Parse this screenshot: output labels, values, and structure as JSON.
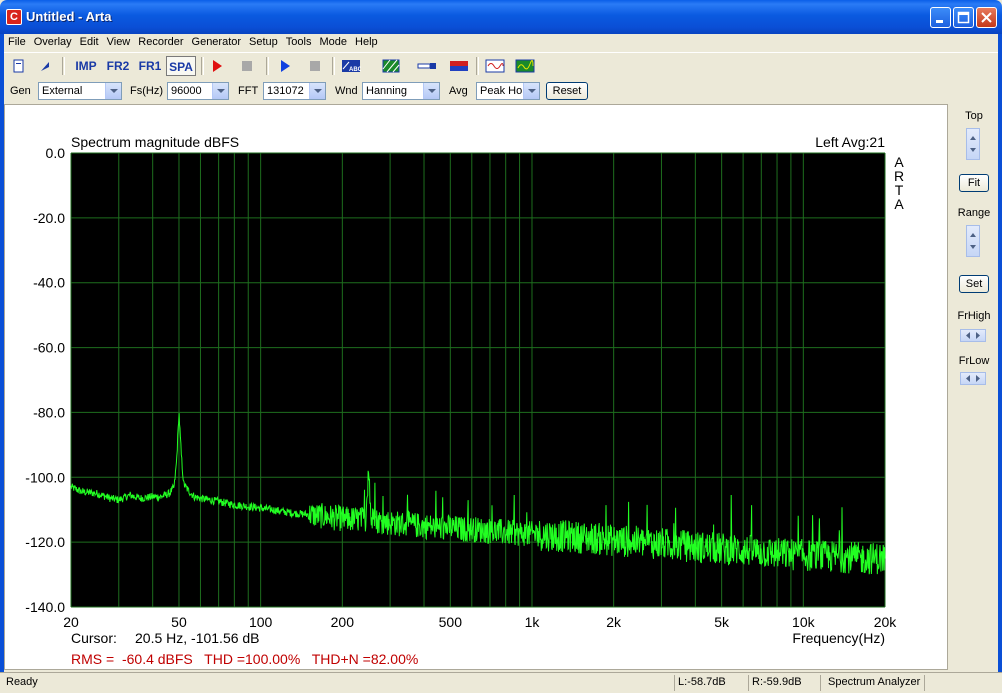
{
  "window": {
    "title": "Untitled - Arta",
    "icon": "app-c-icon"
  },
  "menu": [
    "File",
    "Overlay",
    "Edit",
    "View",
    "Recorder",
    "Generator",
    "Setup",
    "Tools",
    "Mode",
    "Help"
  ],
  "toolbar": {
    "imp": "IMP",
    "fr2": "FR2",
    "fr1": "FR1",
    "spa": "SPA"
  },
  "params": {
    "gen_label": "Gen",
    "gen_value": "External",
    "fs_label": "Fs(Hz)",
    "fs_value": "96000",
    "fft_label": "FFT",
    "fft_value": "131072",
    "wnd_label": "Wnd",
    "wnd_value": "Hanning",
    "avg_label": "Avg",
    "avg_value": "Peak Ho",
    "reset_label": "Reset"
  },
  "plot": {
    "title": "Spectrum magnitude dBFS",
    "channel_info": "Left  Avg:21",
    "watermark": "ARTA",
    "cursor_label": "Cursor:",
    "cursor_value": "20.5 Hz, -101.56 dB",
    "stats": "RMS =  -60.4 dBFS   THD =100.00%   THD+N =82.00%",
    "colors": {
      "background": "#000000",
      "grid": "#1e6e1e",
      "trace": "#22ff22",
      "stats": "#c00000"
    }
  },
  "chart_data": {
    "type": "line",
    "title": "Spectrum magnitude dBFS",
    "xlabel": "Frequency(Hz)",
    "ylabel": "",
    "xscale": "log",
    "xlim": [
      20,
      20000
    ],
    "ylim": [
      -140,
      0
    ],
    "xtick_labels": [
      "20",
      "50",
      "100",
      "200",
      "500",
      "1k",
      "2k",
      "5k",
      "10k",
      "20k"
    ],
    "xtick_values": [
      20,
      50,
      100,
      200,
      500,
      1000,
      2000,
      5000,
      10000,
      20000
    ],
    "ytick_labels": [
      "0.0",
      "-20.0",
      "-40.0",
      "-60.0",
      "-80.0",
      "-100.0",
      "-120.0",
      "-140.0"
    ],
    "ytick_values": [
      0,
      -20,
      -40,
      -60,
      -80,
      -100,
      -120,
      -140
    ],
    "grid": true,
    "series": [
      {
        "x": [
          20,
          22,
          25,
          28,
          30,
          33,
          36,
          40,
          43,
          46,
          48,
          49,
          50,
          51,
          52,
          54,
          57,
          60,
          65,
          70,
          75,
          80,
          90,
          100,
          110,
          120,
          130,
          150,
          170,
          190,
          210,
          230,
          245,
          250,
          255,
          270,
          300,
          340,
          400,
          450,
          500,
          550,
          600,
          700,
          800,
          1000,
          1200,
          1500,
          1800,
          2000,
          2500,
          3000,
          3500,
          4000,
          5000,
          6000,
          7000,
          8000,
          10000,
          12000,
          14000,
          16000,
          18000,
          20000
        ],
        "y": [
          -103,
          -104.5,
          -105,
          -106.5,
          -107,
          -105.5,
          -106.5,
          -106,
          -106,
          -105,
          -103,
          -95,
          -80,
          -93,
          -102,
          -104,
          -106,
          -106.5,
          -107,
          -107.5,
          -108,
          -108.5,
          -109,
          -109.5,
          -110,
          -110.5,
          -111,
          -111.5,
          -112,
          -112.5,
          -113,
          -113,
          -113,
          -96,
          -113,
          -113.5,
          -114,
          -114.5,
          -115,
          -115.5,
          -115.5,
          -116,
          -116,
          -116.5,
          -117,
          -117.5,
          -118,
          -118.5,
          -119,
          -119.5,
          -120,
          -120.5,
          -121,
          -121.5,
          -122,
          -122.5,
          -123,
          -123.5,
          -124,
          -124.5,
          -124.5,
          -125,
          -125,
          -125
        ]
      }
    ]
  },
  "side": {
    "top_label": "Top",
    "fit_label": "Fit",
    "range_label": "Range",
    "set_label": "Set",
    "frhigh_label": "FrHigh",
    "frlow_label": "FrLow"
  },
  "status": {
    "ready": "Ready",
    "left_level": "L:-58.7dB",
    "right_level": "R:-59.9dB",
    "mode": "Spectrum Analyzer"
  }
}
